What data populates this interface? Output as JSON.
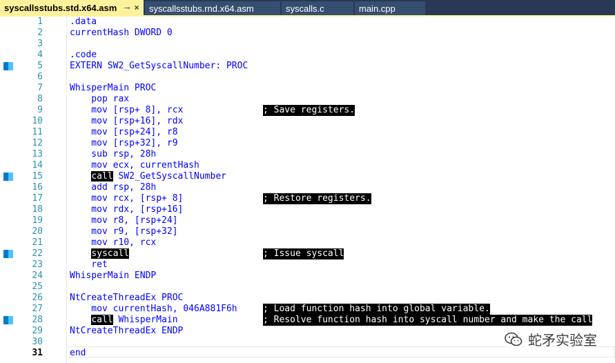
{
  "tabs": [
    {
      "label": "syscallsstubs.std.x64.asm",
      "active": true,
      "pin_icon": "pin-icon",
      "close_icon": "close-icon"
    },
    {
      "label": "syscallsstubs.rnd.x64.asm",
      "active": false
    },
    {
      "label": "syscalls.c",
      "active": false
    },
    {
      "label": "main.cpp",
      "active": false
    }
  ],
  "editor": {
    "current_line": 31,
    "lines": [
      {
        "n": "1",
        "code": ".data"
      },
      {
        "n": "2",
        "code": "currentHash DWORD 0"
      },
      {
        "n": "3",
        "code": ""
      },
      {
        "n": "4",
        "code": ".code"
      },
      {
        "n": "5",
        "code": "EXTERN SW2_GetSyscallNumber: PROC",
        "marker": true
      },
      {
        "n": "6",
        "code": ""
      },
      {
        "n": "7",
        "code": "WhisperMain PROC"
      },
      {
        "n": "8",
        "code": "    pop rax"
      },
      {
        "n": "9",
        "code": "    mov [rsp+ 8], rcx",
        "comment": "; Save registers."
      },
      {
        "n": "10",
        "code": "    mov [rsp+16], rdx"
      },
      {
        "n": "11",
        "code": "    mov [rsp+24], r8"
      },
      {
        "n": "12",
        "code": "    mov [rsp+32], r9"
      },
      {
        "n": "13",
        "code": "    sub rsp, 28h"
      },
      {
        "n": "14",
        "code": "    mov ecx, currentHash"
      },
      {
        "n": "15",
        "pre": "    ",
        "hl": "call",
        "post": " SW2_GetSyscallNumber",
        "marker": true
      },
      {
        "n": "16",
        "code": "    add rsp, 28h"
      },
      {
        "n": "17",
        "code": "    mov rcx, [rsp+ 8]",
        "comment": "; Restore registers."
      },
      {
        "n": "18",
        "code": "    mov rdx, [rsp+16]"
      },
      {
        "n": "19",
        "code": "    mov r8, [rsp+24]"
      },
      {
        "n": "20",
        "code": "    mov r9, [rsp+32]"
      },
      {
        "n": "21",
        "code": "    mov r10, rcx"
      },
      {
        "n": "22",
        "pre": "    ",
        "hl": "syscall",
        "post": "",
        "comment": "; Issue syscall",
        "marker": true
      },
      {
        "n": "23",
        "code": "    ret"
      },
      {
        "n": "24",
        "code": "WhisperMain ENDP"
      },
      {
        "n": "25",
        "code": ""
      },
      {
        "n": "26",
        "code": "NtCreateThreadEx PROC"
      },
      {
        "n": "27",
        "code": "    mov currentHash, 046A881F6h",
        "comment": "; Load function hash into global variable."
      },
      {
        "n": "28",
        "pre": "    ",
        "hl": "call",
        "post": " WhisperMain",
        "comment": "; Resolve function hash into syscall number and make the call",
        "marker": true
      },
      {
        "n": "29",
        "code": "NtCreateThreadEx ENDP"
      },
      {
        "n": "30",
        "code": ""
      },
      {
        "n": "31",
        "code": "end"
      }
    ]
  },
  "watermark": {
    "text": "蛇矛实验室",
    "icon": "wechat-icon"
  },
  "colors": {
    "tab_active": "#fff29d",
    "tabbar": "#293955",
    "keyword": "#0000ff",
    "line_number": "#2b91af",
    "marker": "#007acc"
  }
}
